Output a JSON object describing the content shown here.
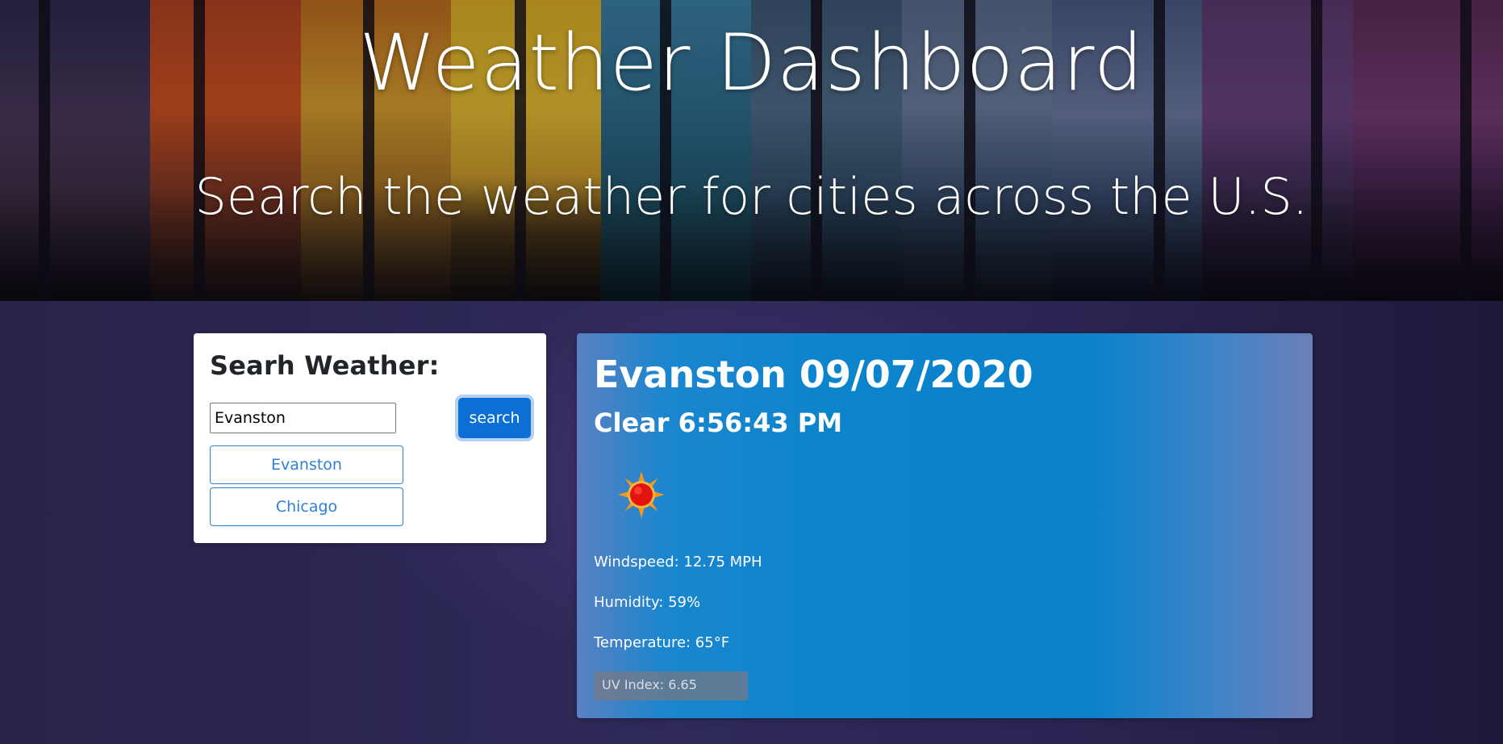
{
  "hero": {
    "title": "Weather Dashboard",
    "subtitle": "Search the weather for cities across the U.S."
  },
  "search": {
    "heading": "Searh Weather:",
    "input_value": "Evanston",
    "button_label": "search",
    "history": [
      "Evanston",
      "Chicago"
    ]
  },
  "weather": {
    "city_date": "Evanston 09/07/2020",
    "condition_time": "Clear 6:56:43 PM",
    "icon": "sun-icon",
    "windspeed": "Windspeed: 12.75 MPH",
    "humidity": "Humidity: 59%",
    "temperature": "Temperature: 65°F",
    "uv_index": "UV Index: 6.65"
  },
  "colors": {
    "accent": "#0b6fd6",
    "history_border": "#2f7fd6",
    "card_blue": "#0a82cb",
    "page_bg": "#2a2550"
  }
}
